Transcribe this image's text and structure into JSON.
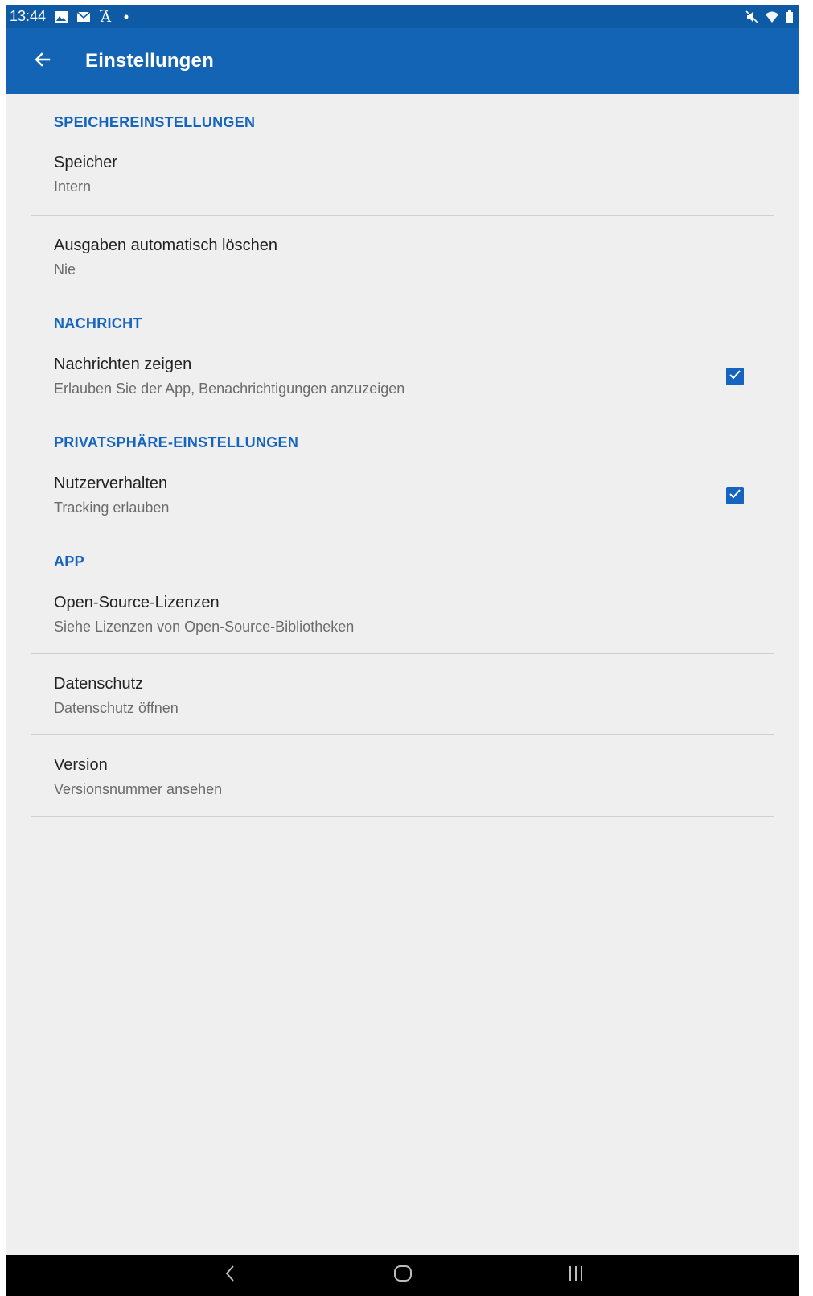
{
  "status_bar": {
    "time": "13:44",
    "left_icons": [
      "gallery-icon",
      "mail-icon",
      "translate-icon",
      "dot-icon"
    ],
    "right_icons": [
      "mute-icon",
      "wifi-icon",
      "battery-icon"
    ]
  },
  "app_bar": {
    "title": "Einstellungen",
    "back_icon": "arrow-back-icon",
    "background": "#1364b4"
  },
  "accent_color": "#1565c0",
  "sections": {
    "storage": {
      "header": "SPEICHEREINSTELLUNGEN",
      "items": [
        {
          "title": "Speicher",
          "summary": "Intern"
        },
        {
          "title": "Ausgaben automatisch löschen",
          "summary": "Nie"
        }
      ]
    },
    "message": {
      "header": "NACHRICHT",
      "items": [
        {
          "title": "Nachrichten zeigen",
          "summary": "Erlauben Sie der App, Benachrichtigungen anzuzeigen",
          "checked": true
        }
      ]
    },
    "privacy": {
      "header": "PRIVATSPHÄRE-EINSTELLUNGEN",
      "items": [
        {
          "title": "Nutzerverhalten",
          "summary": "Tracking erlauben",
          "checked": true
        }
      ]
    },
    "app": {
      "header": "APP",
      "items": [
        {
          "title": "Open-Source-Lizenzen",
          "summary": "Siehe Lizenzen von Open-Source-Bibliotheken"
        },
        {
          "title": "Datenschutz",
          "summary": "Datenschutz öffnen"
        },
        {
          "title": "Version",
          "summary": "Versionsnummer ansehen"
        }
      ]
    }
  },
  "nav_bar": {
    "buttons": [
      "back-nav-icon",
      "home-nav-icon",
      "recents-nav-icon"
    ]
  }
}
